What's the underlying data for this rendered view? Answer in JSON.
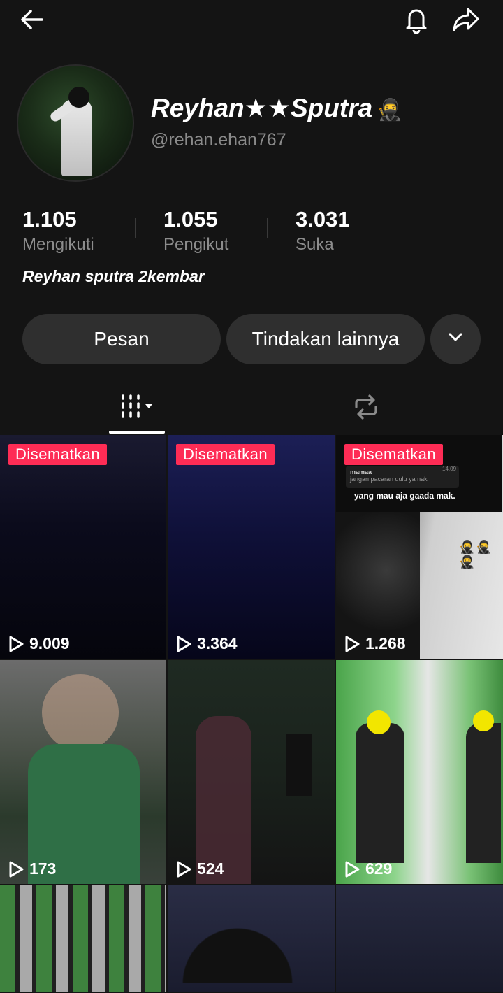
{
  "icons": {
    "back": "arrow-left-icon",
    "notification": "bell-icon",
    "share": "share-arrow-icon",
    "tab_videos": "grid-icon",
    "tab_reposts": "repost-icon",
    "dropdown": "chevron-down-icon",
    "play": "play-icon"
  },
  "profile": {
    "display_name": "Reyhan★★Sputra",
    "name_emoji": "🥷",
    "username": "@rehan.ehan767",
    "bio": "Reyhan sputra 2kembar"
  },
  "stats": [
    {
      "value": "1.105",
      "label": "Mengikuti"
    },
    {
      "value": "1.055",
      "label": "Pengikut"
    },
    {
      "value": "3.031",
      "label": "Suka"
    }
  ],
  "actions": {
    "message": "Pesan",
    "more": "Tindakan lainnya"
  },
  "videos": [
    {
      "pinned_label": "Disematkan",
      "views": "9.009"
    },
    {
      "pinned_label": "Disematkan",
      "views": "3.364"
    },
    {
      "pinned_label": "Disematkan",
      "views": "1.268",
      "overlay": {
        "chat_name": "mamaa",
        "chat_msg": "jangan pacaran dulu ya nak",
        "chat_time": "14.09",
        "caption": "yang mau aja gaada mak."
      }
    },
    {
      "views": "173"
    },
    {
      "views": "524"
    },
    {
      "views": "629"
    },
    {
      "views": ""
    },
    {
      "views": ""
    },
    {
      "views": ""
    }
  ],
  "colors": {
    "background": "#141414",
    "button": "#2f2f2f",
    "pinned_badge": "#fe2c55",
    "muted_text": "#8a8a8a"
  }
}
